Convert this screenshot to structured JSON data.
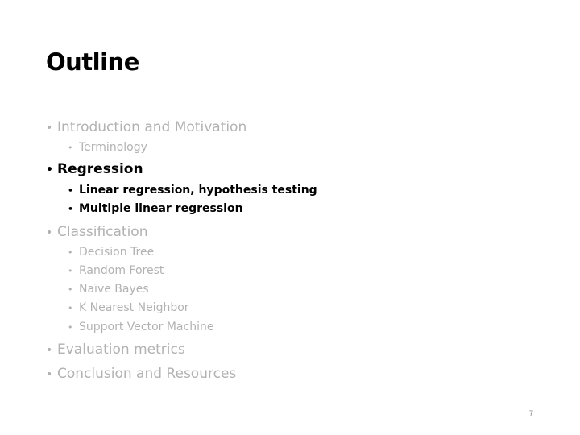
{
  "slide": {
    "title": "Outline",
    "bullet_glyph": "•",
    "items": [
      {
        "label": "Introduction and Motivation",
        "state": "dim"
      },
      {
        "label": "Terminology",
        "state": "dim"
      },
      {
        "label": "Regression",
        "state": "active"
      },
      {
        "label": "Linear regression, hypothesis testing",
        "state": "active"
      },
      {
        "label": "Multiple linear regression",
        "state": "active"
      },
      {
        "label": "Classification",
        "state": "dim"
      },
      {
        "label": "Decision Tree",
        "state": "dim"
      },
      {
        "label": "Random Forest",
        "state": "dim"
      },
      {
        "label": "Naïve Bayes",
        "state": "dim"
      },
      {
        "label": "K Nearest Neighbor",
        "state": "dim"
      },
      {
        "label": "Support Vector Machine",
        "state": "dim"
      },
      {
        "label": "Evaluation metrics",
        "state": "dim"
      },
      {
        "label": "Conclusion and Resources",
        "state": "dim"
      }
    ],
    "page_number": "7"
  },
  "colors": {
    "active_text": "#000000",
    "dimmed_text": "#b2b2b2",
    "page_number": "#7f7f7f"
  }
}
